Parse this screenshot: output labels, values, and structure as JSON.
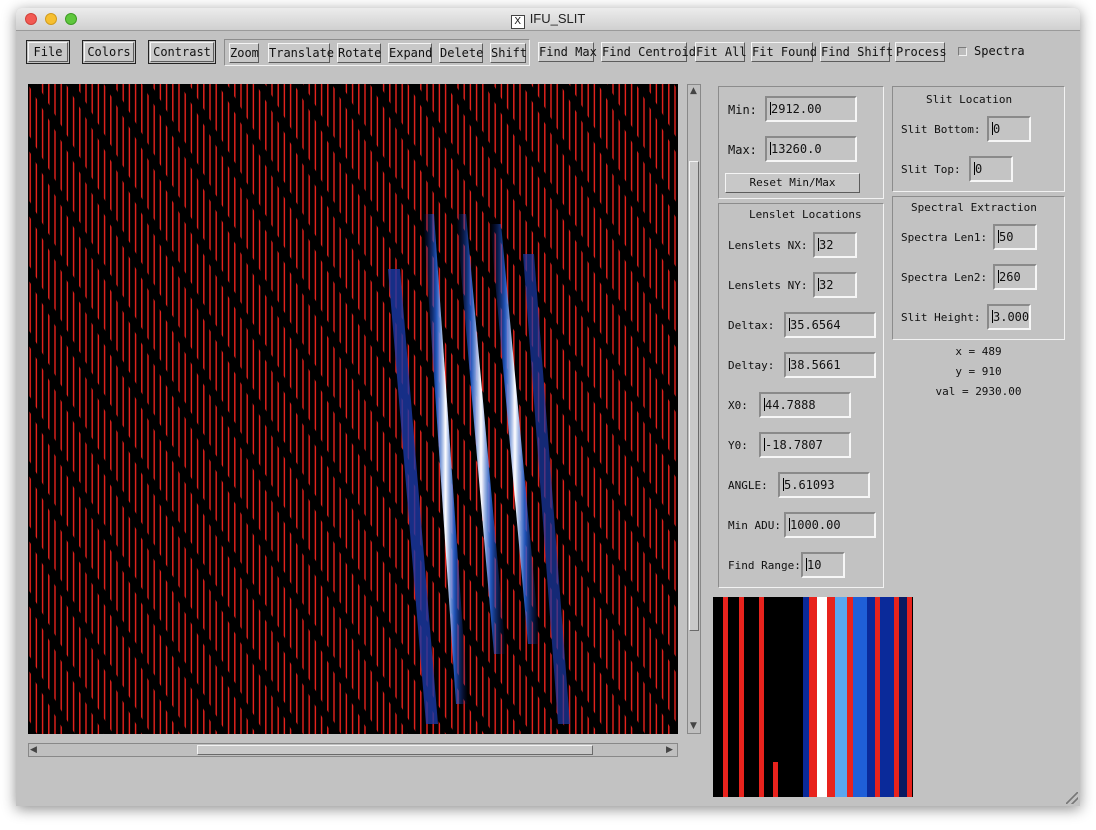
{
  "window": {
    "title": "IFU_SLIT"
  },
  "toolbar": {
    "file": "File",
    "colors": "Colors",
    "contrast": "Contrast",
    "zoom": "Zoom",
    "translate": "Translate",
    "rotate": "Rotate",
    "expand": "Expand",
    "delete": "Delete",
    "shift": "Shift",
    "find_max": "Find Max",
    "find_centroid": "Find Centroid",
    "fit_all": "Fit All",
    "fit_found": "Fit Found",
    "find_shift": "Find Shift",
    "process": "Process",
    "spectra_label": "Spectra"
  },
  "minmax": {
    "min_label": "Min:",
    "min_value": "2912.00",
    "max_label": "Max:",
    "max_value": "13260.0",
    "reset_label": "Reset Min/Max"
  },
  "lenslets": {
    "title": "Lenslet Locations",
    "nx_label": "Lenslets NX:",
    "nx_value": "32",
    "ny_label": "Lenslets NY:",
    "ny_value": "32",
    "deltax_label": "Deltax:",
    "deltax_value": "35.6564",
    "deltay_label": "Deltay:",
    "deltay_value": "38.5661",
    "x0_label": "X0:",
    "x0_value": "44.7888",
    "y0_label": "Y0:",
    "y0_value": "-18.7807",
    "angle_label": "ANGLE:",
    "angle_value": "5.61093",
    "minadu_label": "Min ADU:",
    "minadu_value": "1000.00",
    "findrange_label": "Find Range:",
    "findrange_value": "10"
  },
  "slit": {
    "title": "Slit Location",
    "bottom_label": "Slit Bottom:",
    "bottom_value": "0",
    "top_label": "Slit Top:",
    "top_value": "0"
  },
  "extraction": {
    "title": "Spectral Extraction",
    "len1_label": "Spectra Len1:",
    "len1_value": "50",
    "len2_label": "Spectra Len2:",
    "len2_value": "260",
    "height_label": "Slit Height:",
    "height_value": "3.000"
  },
  "cursor": {
    "x": "x = 489",
    "y": "y = 910",
    "val": "val = 2930.00"
  },
  "colors": {
    "overlay": "#e8231d",
    "background": "#000000",
    "spectrum_blue": "#1f5fd8",
    "panel": "#c2c2c2"
  }
}
